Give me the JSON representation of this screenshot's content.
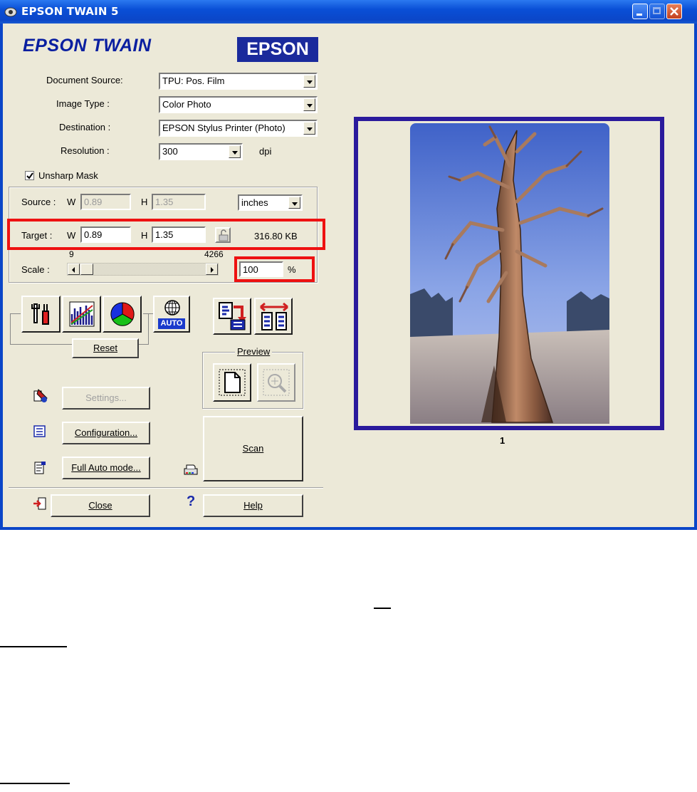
{
  "window": {
    "title": "EPSON TWAIN 5",
    "logo_text": "EPSON TWAIN",
    "brand": "EPSON"
  },
  "settings": {
    "document_source_label": "Document Source:",
    "document_source_value": "TPU: Pos. Film",
    "image_type_label": "Image Type :",
    "image_type_value": "Color Photo",
    "destination_label": "Destination :",
    "destination_value": "EPSON Stylus Printer (Photo)",
    "resolution_label": "Resolution :",
    "resolution_value": "300",
    "resolution_unit": "dpi",
    "unsharp_mask_label": "Unsharp Mask",
    "unsharp_mask_checked": true
  },
  "source": {
    "label": "Source :",
    "w_label": "W",
    "w_value": "0.89",
    "h_label": "H",
    "h_value": "1.35",
    "unit": "inches"
  },
  "target": {
    "label": "Target :",
    "w_label": "W",
    "w_value": "0.89",
    "h_label": "H",
    "h_value": "1.35",
    "file_size": "316.80 KB"
  },
  "scale": {
    "label": "Scale :",
    "min": "9",
    "max": "4266",
    "value": "100",
    "unit": "%"
  },
  "buttons": {
    "reset": "Reset",
    "preview_group": "Preview",
    "settings": "Settings...",
    "configuration": "Configuration...",
    "full_auto": "Full Auto mode...",
    "scan": "Scan",
    "close": "Close",
    "help": "Help",
    "help_icon": "?",
    "auto": "AUTO"
  },
  "preview": {
    "frame_number": "1"
  },
  "colors": {
    "title_bar": "#0b46c8",
    "dialog_bg": "#ece9d8",
    "highlight": "#ee1111",
    "preview_frame": "#2a1a9c"
  }
}
